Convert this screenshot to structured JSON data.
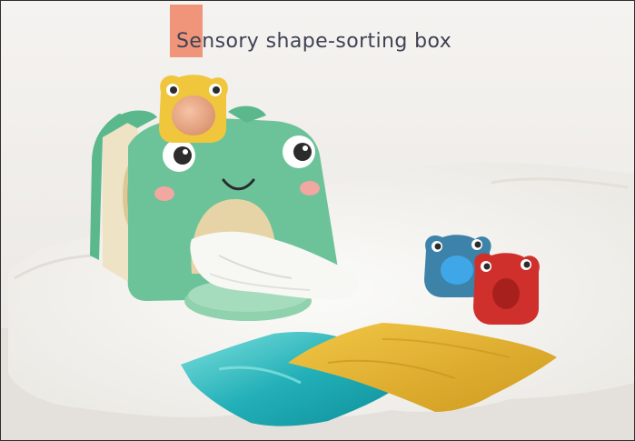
{
  "caption": {
    "text": "Sensory shape-sorting box",
    "accent_color": "#f0957a",
    "text_color": "#3e4254"
  },
  "photo": {
    "subject": "frog-shape-sorting-box",
    "colors": {
      "frog_green": "#6cc39a",
      "box_cream": "#f3e9cf",
      "fur_rug": "#f6f5f2",
      "yellow_cloth": "#e4b632",
      "teal_cloth": "#2bb5bc",
      "blue_frog": "#3d82a8",
      "red_frog": "#d0302c"
    }
  }
}
